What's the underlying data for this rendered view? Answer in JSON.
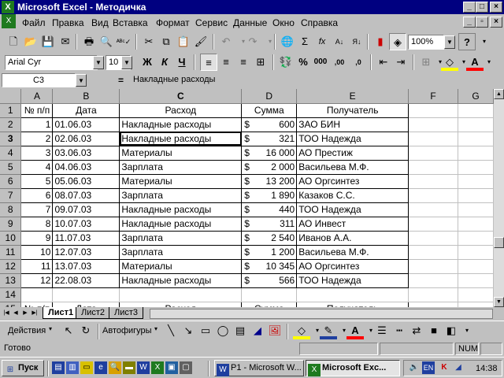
{
  "window": {
    "title": "Microsoft Excel - Методичка",
    "minimize": "_",
    "maximize": "□",
    "close": "×",
    "app_icon": "excel-icon"
  },
  "menu": {
    "items": [
      "Файл",
      "Правка",
      "Вид",
      "Вставка",
      "Формат",
      "Сервис",
      "Данные",
      "Окно",
      "Справка"
    ],
    "doc_minimize": "_",
    "doc_restore": "▫",
    "doc_close": "×"
  },
  "standard_toolbar": {
    "zoom_value": "100%",
    "help": "?"
  },
  "format_toolbar": {
    "font_name": "Arial Cyr",
    "font_size": "10",
    "bold": "Ж",
    "italic": "К",
    "underline": "Ч",
    "percent": "%",
    "thousands": "000",
    "inc_decimal": ",00",
    "dec_decimal": ",0"
  },
  "formula_bar": {
    "name_box": "C3",
    "equals": "=",
    "content": "Накладные расходы"
  },
  "sheet": {
    "columns": [
      "A",
      "B",
      "C",
      "D",
      "E",
      "F",
      "G"
    ],
    "header_row": [
      "№ п/п",
      "Дата",
      "Расход",
      "Сумма",
      "Получатель"
    ],
    "rows": [
      {
        "n": "1",
        "date": "01.06.03",
        "expense": "Накладные расходы",
        "cur": "$",
        "sum": "600",
        "recipient": "ЗАО БИН"
      },
      {
        "n": "2",
        "date": "02.06.03",
        "expense": "Накладные расходы",
        "cur": "$",
        "sum": "321",
        "recipient": "ТОО Надежда"
      },
      {
        "n": "3",
        "date": "03.06.03",
        "expense": "Материалы",
        "cur": "$",
        "sum": "16 000",
        "recipient": "АО Престиж"
      },
      {
        "n": "4",
        "date": "04.06.03",
        "expense": "Зарплата",
        "cur": "$",
        "sum": "2 000",
        "recipient": "Васильева М.Ф."
      },
      {
        "n": "5",
        "date": "05.06.03",
        "expense": "Материалы",
        "cur": "$",
        "sum": "13 200",
        "recipient": "АО Оргсинтез"
      },
      {
        "n": "6",
        "date": "08.07.03",
        "expense": "Зарплата",
        "cur": "$",
        "sum": "1 890",
        "recipient": "Казаков С.С."
      },
      {
        "n": "7",
        "date": "09.07.03",
        "expense": "Накладные расходы",
        "cur": "$",
        "sum": "440",
        "recipient": "ТОО Надежда"
      },
      {
        "n": "8",
        "date": "10.07.03",
        "expense": "Накладные расходы",
        "cur": "$",
        "sum": "311",
        "recipient": "АО Инвест"
      },
      {
        "n": "9",
        "date": "11.07.03",
        "expense": "Зарплата",
        "cur": "$",
        "sum": "2 540",
        "recipient": "Иванов А.А."
      },
      {
        "n": "10",
        "date": "12.07.03",
        "expense": "Зарплата",
        "cur": "$",
        "sum": "1 200",
        "recipient": "Васильева М.Ф."
      },
      {
        "n": "11",
        "date": "13.07.03",
        "expense": "Материалы",
        "cur": "$",
        "sum": "10 345",
        "recipient": "АО Оргсинтез"
      },
      {
        "n": "12",
        "date": "22.08.03",
        "expense": "Накладные расходы",
        "cur": "$",
        "sum": "566",
        "recipient": "ТОО Надежда"
      }
    ],
    "row_numbers": [
      "1",
      "2",
      "3",
      "4",
      "5",
      "6",
      "7",
      "8",
      "9",
      "10",
      "11",
      "12",
      "13",
      "14",
      "15"
    ],
    "row15_partial": [
      "№ п/п",
      "Дата",
      "Расход",
      "Сумма",
      "Получатель"
    ]
  },
  "tabs": {
    "items": [
      "Лист1",
      "Лист2",
      "Лист3"
    ],
    "active": "Лист1"
  },
  "drawing_toolbar": {
    "actions": "Действия",
    "autoshapes": "Автофигуры"
  },
  "status": {
    "ready": "Готово",
    "num": "NUM"
  },
  "taskbar": {
    "start": "Пуск",
    "tasks": [
      "P1 - Microsoft W...",
      "Microsoft Exc..."
    ],
    "lang": "EN",
    "time": "14:38"
  },
  "colors": {
    "title_bg": "#000080",
    "excel_green": "#1f7a1f",
    "word_blue": "#1f3f9f",
    "highlight_yellow": "#ffff00",
    "font_red": "#ff0000"
  }
}
